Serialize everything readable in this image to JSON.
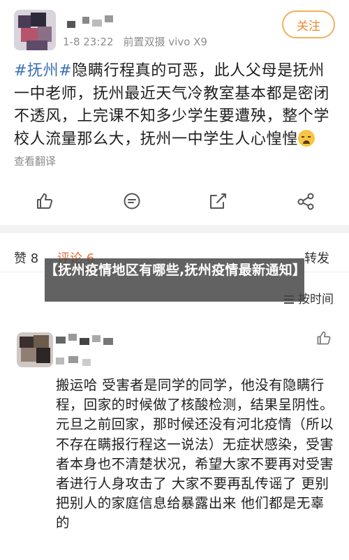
{
  "post": {
    "timestamp": "1-8 23:22",
    "source": "前置双摄 vivo X9",
    "follow_label": "关注",
    "hashtag": "#抚州#",
    "body": "隐瞒行程真的可恶，此人父母是抚州一中老师，抚州最近天气冷教室基本都是密闭不透风，上完课不知多少学生要遭殃，整个学校人流量那么大，抚州一中学生人心惶惶",
    "emoji_icon": "weary-face-emoji",
    "translate_label": "查看翻译"
  },
  "actions": {
    "like_icon": "thumbs-up-icon",
    "comment_icon": "comment-icon",
    "share_icon": "share-icon",
    "more_icon": "forward-icon"
  },
  "tabs": {
    "likes": "赞 8",
    "comments": "评论 6",
    "reposts": "转发"
  },
  "sort": {
    "label": "按时间"
  },
  "banner": {
    "text": "【抚州疫情地区有哪些,抚州疫情最新通知】"
  },
  "comment": {
    "text": "搬运哈 受害者是同学的同学，他没有隐瞒行程，回家的时候做了核酸检测，结果呈阴性。元旦之前回家，那时候还没有河北疫情（所以不存在瞒报行程这一说法）无症状感染，受害者本身也不清楚状况，希望大家不要再对受害者进行人身攻击了 大家不要再乱传谣了 更别把别人的家庭信息给暴露出来 他们都是无辜的",
    "like_icon": "thumbs-up-icon"
  },
  "colors": {
    "accent": "#ee7b33",
    "hashtag": "#3a6fb8",
    "follow_border": "#f0b060"
  }
}
